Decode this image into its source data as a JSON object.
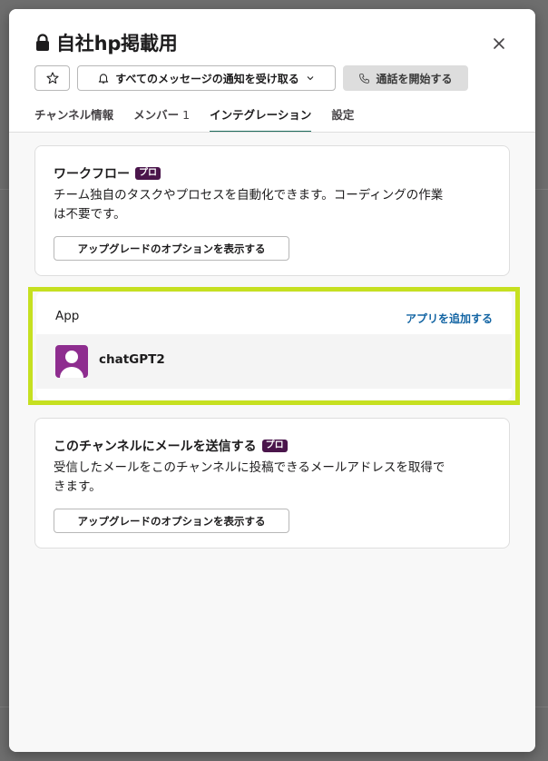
{
  "channel": {
    "name": "自社hp掲載用"
  },
  "header": {
    "notify_label": "すべてのメッセージの通知を受け取る",
    "call_label": "通話を開始する"
  },
  "tabs": [
    {
      "label": "チャンネル情報"
    },
    {
      "label": "メンバー",
      "count": "1"
    },
    {
      "label": "インテグレーション",
      "active": true
    },
    {
      "label": "設定"
    }
  ],
  "workflow": {
    "title": "ワークフロー",
    "badge": "プロ",
    "desc_line1": "チーム独自のタスクやプロセスを自動化できます。コーディングの作業",
    "desc_line2": "は不要です。",
    "button": "アップグレードのオプションを表示する"
  },
  "apps": {
    "label": "App",
    "add_label": "アプリを追加する",
    "items": [
      {
        "name": "chatGPT2",
        "icon": "person-avatar-icon"
      }
    ]
  },
  "email": {
    "title": "このチャンネルにメールを送信する",
    "badge": "プロ",
    "desc_line1": "受信したメールをこのチャンネルに投稿できるメールアドレスを取得で",
    "desc_line2": "きます。",
    "button": "アップグレードのオプションを表示する"
  },
  "colors": {
    "highlight": "#c6e020",
    "badge": "#4a154b",
    "link": "#1264a3",
    "active_tab": "#1d6b5c",
    "avatar": "#8e2d8f"
  }
}
